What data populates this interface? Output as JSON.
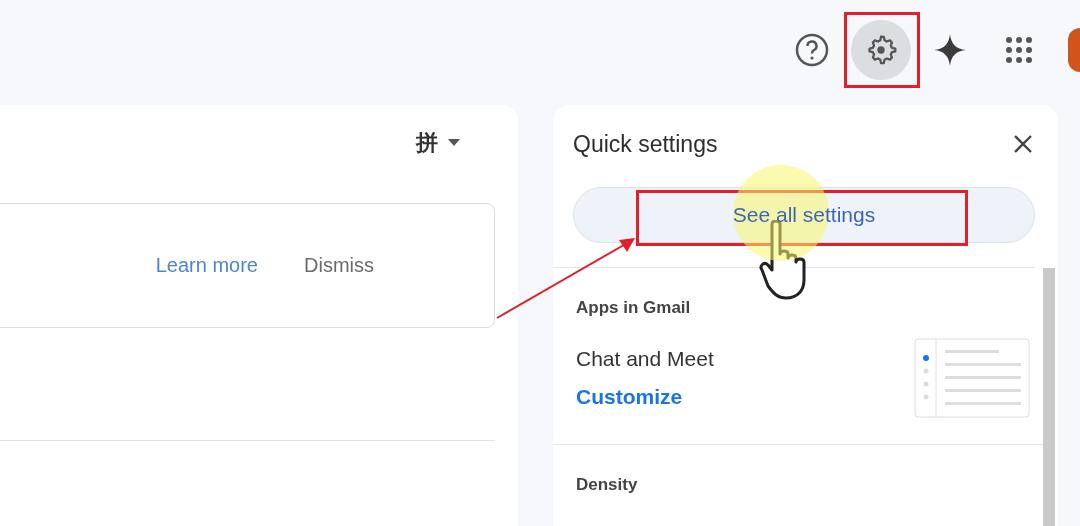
{
  "top_bar": {
    "icons": [
      {
        "kind": "help",
        "selected": false,
        "annotated": false
      },
      {
        "kind": "settings",
        "selected": true,
        "annotated": true
      },
      {
        "kind": "sparkle",
        "selected": false,
        "annotated": false
      },
      {
        "kind": "apps",
        "selected": false,
        "annotated": false
      }
    ]
  },
  "main": {
    "input_tool": {
      "label": "拼"
    },
    "notice": {
      "actions": [
        {
          "kind": "link",
          "label": "Learn more"
        },
        {
          "kind": "plain",
          "label": "Dismiss"
        }
      ]
    }
  },
  "quick_settings": {
    "title": "Quick settings",
    "see_all": {
      "label": "See all settings",
      "annotated": true
    },
    "sections": [
      {
        "heading": "Apps in Gmail",
        "items": [
          {
            "title": "Chat and Meet",
            "action": "Customize"
          }
        ]
      },
      {
        "heading": "Density"
      }
    ]
  }
}
